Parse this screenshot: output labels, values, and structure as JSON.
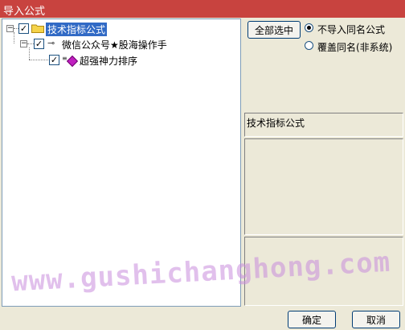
{
  "window": {
    "title": "导入公式"
  },
  "tree": {
    "root": {
      "label": "技术指标公式",
      "checked": true,
      "expanded": true
    },
    "child": {
      "label": "微信公众号★股海操作手",
      "checked": true,
      "expanded": true
    },
    "leaf": {
      "label": "超强神力排序",
      "checked": true
    }
  },
  "controls": {
    "select_all_label": "全部选中",
    "options": [
      {
        "label": "不导入同名公式",
        "selected": true
      },
      {
        "label": "覆盖同名(非系统)",
        "selected": false
      }
    ]
  },
  "info": {
    "category_label": "技术指标公式"
  },
  "footer": {
    "ok_label": "确定",
    "cancel_label": "取消"
  },
  "watermark": {
    "text": "www.gushichanghong.com"
  },
  "colors": {
    "titlebar": "#c8433f",
    "selection": "#316ac5",
    "watermark": "#c88cdc"
  }
}
